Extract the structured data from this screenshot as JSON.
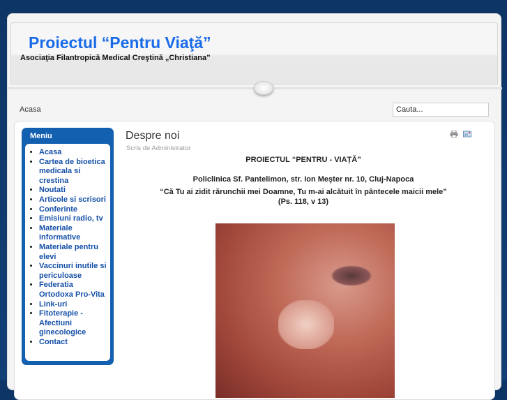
{
  "header": {
    "title": "Proiectul “Pentru Viaţă”",
    "subtitle": "Asociaţia Filantropică Medical Creştină „Christiana”"
  },
  "breadcrumb": "Acasa",
  "search": {
    "placeholder": "Cauta..."
  },
  "menu": {
    "title": "Meniu",
    "items": [
      "Acasa",
      "Cartea de bioetica medicala si crestina",
      "Noutati",
      "Articole si scrisori",
      "Conferinte",
      "Emisiuni radio, tv",
      "Materiale informative",
      "Materiale pentru elevi",
      "Vaccinuri inutile si periculoase",
      "Federatia Ortodoxa Pro-Vita",
      "Link-uri",
      "Fitoterapie - Afectiuni ginecologice",
      "Contact"
    ]
  },
  "article": {
    "title": "Despre noi",
    "author": "Scris de Administrator",
    "heading": "PROIECTUL  “PENTRU  -  VIAȚĂ”",
    "address": "Policlinica Sf. Pantelimon, str. Ion Meşter nr. 10, Cluj-Napoca",
    "quote": "“Că Tu ai zidit rărunchii mei Doamne, Tu m-ai alcătuit în pântecele maicii mele”",
    "reference": "(Ps. 118, v 13)"
  }
}
